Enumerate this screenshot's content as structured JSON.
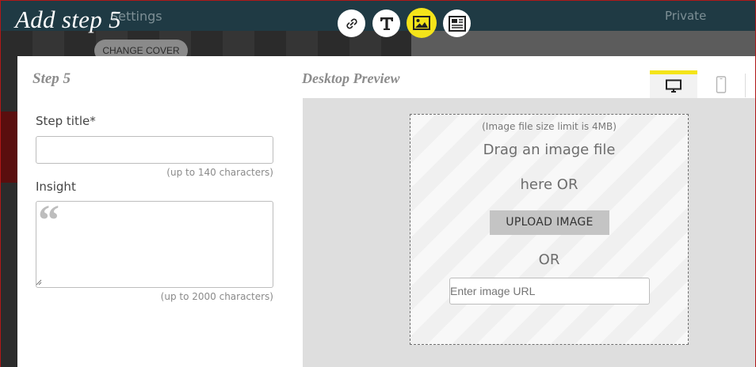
{
  "background": {
    "settings_label": "Settings",
    "privacy_label": "Private",
    "change_cover_label": "CHANGE COVER"
  },
  "modal": {
    "heading": "Add step 5",
    "step_label": "Step 5",
    "toolbar": [
      {
        "icon": "link-icon",
        "active": false
      },
      {
        "icon": "text-icon",
        "active": false
      },
      {
        "icon": "image-icon",
        "active": true
      },
      {
        "icon": "embed-icon",
        "active": false
      }
    ],
    "accent_color": "#f4e41a"
  },
  "form": {
    "title_label": "Step title*",
    "title_value": "",
    "title_hint": "(up to 140 characters)",
    "insight_label": "Insight",
    "insight_value": "",
    "insight_hint": "(up to 2000 characters)"
  },
  "preview": {
    "label": "Desktop Preview",
    "devices": [
      {
        "icon": "desktop-icon",
        "active": true
      },
      {
        "icon": "mobile-icon",
        "active": false
      }
    ],
    "dropzone": {
      "limit": "(Image file size limit is 4MB)",
      "drag_line1": "Drag an image file",
      "drag_line2": "here OR",
      "upload_label": "UPLOAD IMAGE",
      "or_label": "OR",
      "url_placeholder": "Enter image URL"
    }
  }
}
